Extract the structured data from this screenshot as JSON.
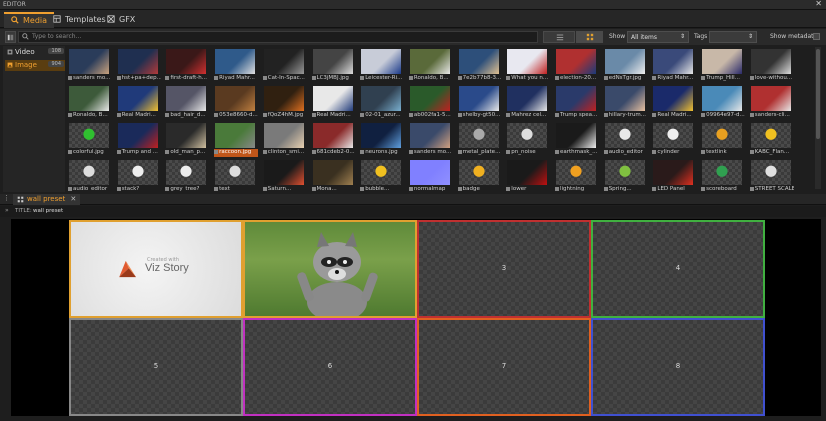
{
  "window": {
    "title": "EDITOR",
    "close_glyph": "✕"
  },
  "tabs": [
    {
      "label": "Media",
      "icon": "search-icon",
      "active": true
    },
    {
      "label": "Templates",
      "icon": "templates-icon",
      "active": false
    },
    {
      "label": "GFX",
      "icon": "gfx-icon",
      "active": false
    }
  ],
  "toolbar": {
    "search_placeholder": "Type to search...",
    "show_label": "Show",
    "show_value": "All items",
    "tags_label": "Tags",
    "tags_value": "",
    "show_metadata_label": "Show metadata"
  },
  "sidebar": {
    "items": [
      {
        "label": "Video",
        "count": "108",
        "selected": false
      },
      {
        "label": "Image",
        "count": "904",
        "selected": true
      }
    ]
  },
  "media_items": [
    {
      "caption": "sanders mo...",
      "color": "#2a3c5a",
      "accent": "#c9a27d"
    },
    {
      "caption": "hst+pa+dep...",
      "color": "#1f2f50",
      "accent": "#b23a3a"
    },
    {
      "caption": "first-draft-h...",
      "color": "#3a1818",
      "accent": "#d03030"
    },
    {
      "caption": "Riyad Mahr...",
      "color": "#2f5a8a",
      "accent": "#e0e0e0"
    },
    {
      "caption": "Cat-In-Spac...",
      "color": "#222",
      "accent": "#999"
    },
    {
      "caption": "LC3jMBJ.jpg",
      "color": "#444",
      "accent": "#ddd"
    },
    {
      "caption": "Leicester-Ri...",
      "color": "#c8ccd8",
      "accent": "#1a3a8a"
    },
    {
      "caption": "Ronaldo, B...",
      "color": "#5a6a3a",
      "accent": "#e8e8e8"
    },
    {
      "caption": "7e2b77b8-3...",
      "color": "#2d4f7a",
      "accent": "#e0c090"
    },
    {
      "caption": "What you n...",
      "color": "#e8e8f0",
      "accent": "#c02020"
    },
    {
      "caption": "election-20...",
      "color": "#b03030",
      "accent": "#1a3a7a"
    },
    {
      "caption": "edNsTgr.jpg",
      "color": "#6a8aa8",
      "accent": "#eee"
    },
    {
      "caption": "Riyad Mahr...",
      "color": "#3a4a7a",
      "accent": "#e8e8e8"
    },
    {
      "caption": "Trump_Hill...",
      "color": "#c8b8a8",
      "accent": "#2a2a6a"
    },
    {
      "caption": "love-withou...",
      "color": "#333",
      "accent": "#ddd"
    },
    {
      "caption": "Ronaldo, B...",
      "color": "#3d5a3a",
      "accent": "#e8e8e8"
    },
    {
      "caption": "Real Madri...",
      "color": "#203a7a",
      "accent": "#f0c030"
    },
    {
      "caption": "bad_hair_d...",
      "color": "#556",
      "accent": "#e8e8e8"
    },
    {
      "caption": "053e8660-d...",
      "color": "#5a3a20",
      "accent": "#c08040"
    },
    {
      "caption": "fQoZ4hM.jpg",
      "color": "#302010",
      "accent": "#e07020"
    },
    {
      "caption": "Real Madri...",
      "color": "#e8e8e8",
      "accent": "#203a7a"
    },
    {
      "caption": "02-01_azur...",
      "color": "#304050",
      "accent": "#7ab0d0"
    },
    {
      "caption": "ab002fa1-5...",
      "color": "#2a5a2a",
      "accent": "#c02020"
    },
    {
      "caption": "shelby-gt50...",
      "color": "#2a4a8a",
      "accent": "#e8e8e8"
    },
    {
      "caption": "Mahrez cel...",
      "color": "#203060",
      "accent": "#e8e8e8"
    },
    {
      "caption": "Trump spea...",
      "color": "#2a3a6a",
      "accent": "#c02020"
    },
    {
      "caption": "hillary-trum...",
      "color": "#3a4a6a",
      "accent": "#e8c0a0"
    },
    {
      "caption": "Real Madri...",
      "color": "#1a2a6a",
      "accent": "#f0c030"
    },
    {
      "caption": "09964e97-d...",
      "color": "#4a8ab8",
      "accent": "#e8e8e8"
    },
    {
      "caption": "sanders-cli...",
      "color": "#b03030",
      "accent": "#e8e8e8"
    },
    {
      "caption": "colorful.jpg",
      "color": "#3a3a3a",
      "accent": "#30c030"
    },
    {
      "caption": "Trump and ...",
      "color": "#1a2a5a",
      "accent": "#c02020"
    },
    {
      "caption": "old_man_p...",
      "color": "#2a2a2a",
      "accent": "#d0c0a0"
    },
    {
      "caption": "raccoon.jpg",
      "color": "#4a7a3a",
      "accent": "#888"
    },
    {
      "caption": "clinton_smi...",
      "color": "#7a7a7a",
      "accent": "#e8d0b0"
    },
    {
      "caption": "681cdeb2-0...",
      "color": "#8a2a2a",
      "accent": "#e8e8e8"
    },
    {
      "caption": "neurons.jpg",
      "color": "#102040",
      "accent": "#60a0e0"
    },
    {
      "caption": "sanders mo...",
      "color": "#3a4a6a",
      "accent": "#d0a080"
    },
    {
      "caption": "metal_plate...",
      "color": "#3a3a3a",
      "accent": "#aaa"
    },
    {
      "caption": "pn_noise",
      "color": "#3a3a3a",
      "accent": "#ddd"
    },
    {
      "caption": "earthmask_...",
      "color": "#1a1a1a",
      "accent": "#eee"
    },
    {
      "caption": "audio_editor",
      "color": "#3a3a3a",
      "accent": "#e8e8e8"
    },
    {
      "caption": "cylinder",
      "color": "#3a3a3a",
      "accent": "#eee"
    },
    {
      "caption": "textlink",
      "color": "#3a3a3a",
      "accent": "#e8a020"
    },
    {
      "caption": "KABC_Flan...",
      "color": "#3a3a3a",
      "accent": "#f0c020"
    },
    {
      "caption": "audio_editor",
      "color": "#3a3a3a",
      "accent": "#ddd"
    },
    {
      "caption": "stack?",
      "color": "#3a3a3a",
      "accent": "#eee"
    },
    {
      "caption": "grey_tree?",
      "color": "#3a3a3a",
      "accent": "#eee"
    },
    {
      "caption": "text",
      "color": "#3a3a3a",
      "accent": "#ddd"
    },
    {
      "caption": "Saturn...",
      "color": "#1a1a1a",
      "accent": "#e05030"
    },
    {
      "caption": "Mona...",
      "color": "#3a3020",
      "accent": "#a08050"
    },
    {
      "caption": "bubble...",
      "color": "#3a3a3a",
      "accent": "#f0c020"
    },
    {
      "caption": "normalmap",
      "color": "#8080ff",
      "accent": "#9090ff"
    },
    {
      "caption": "badge",
      "color": "#3a3a3a",
      "accent": "#f0b020"
    },
    {
      "caption": "lower",
      "color": "#1a1a1a",
      "accent": "#c01010"
    },
    {
      "caption": "lightning",
      "color": "#3a3a3a",
      "accent": "#f0a020"
    },
    {
      "caption": "Spring...",
      "color": "#3a3a3a",
      "accent": "#80c040"
    },
    {
      "caption": "LED Panel",
      "color": "#2a1a1a",
      "accent": "#e03020"
    },
    {
      "caption": "scoreboard",
      "color": "#3a3a3a",
      "accent": "#30a050"
    },
    {
      "caption": "STREET SCALE",
      "color": "#3a3a3a",
      "accent": "#e0e0e0"
    }
  ],
  "selected_media_index": 33,
  "panel": {
    "tab_label": "wall preset",
    "title_label": "TITLE:",
    "title_value": "wall preset"
  },
  "wall": {
    "cells": [
      {
        "label": "",
        "border": "#e0a030",
        "content": "viz-story"
      },
      {
        "label": "",
        "border": "#e0a030",
        "content": "raccoon"
      },
      {
        "label": "3",
        "border": "#c03030",
        "content": "empty"
      },
      {
        "label": "4",
        "border": "#40b040",
        "content": "empty"
      },
      {
        "label": "5",
        "border": "#888888",
        "content": "empty"
      },
      {
        "label": "6",
        "border": "#c030c0",
        "content": "empty"
      },
      {
        "label": "7",
        "border": "#e06020",
        "content": "empty"
      },
      {
        "label": "8",
        "border": "#4050d0",
        "content": "empty"
      }
    ],
    "viz_story_small": "Created with",
    "viz_story_text": "Viz Story"
  }
}
